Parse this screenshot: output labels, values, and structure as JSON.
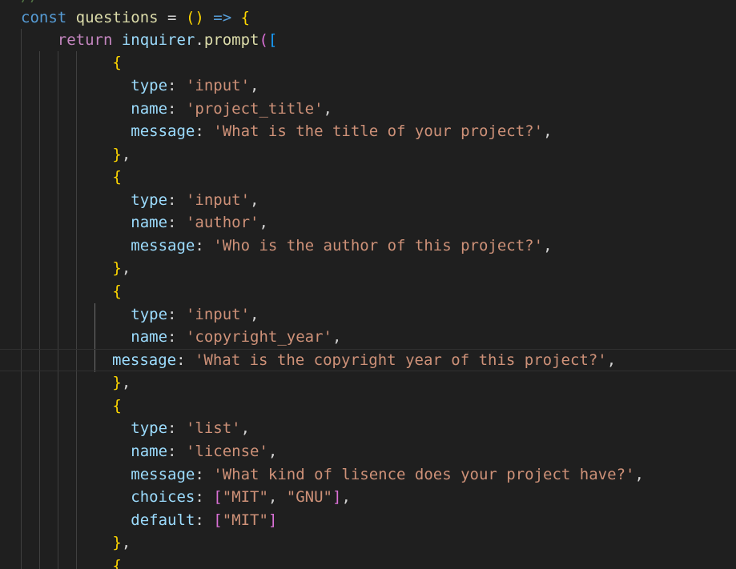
{
  "editor": {
    "ghost_comment": "// ---------------------------------------------------",
    "header": {
      "kw_const": "const",
      "name": "questions",
      "eq": " = ",
      "parens": "()",
      "arrow": " => ",
      "brace": "{"
    },
    "return_line": {
      "kw_return": "return",
      "obj": "inquirer",
      "dot": ".",
      "fn": "prompt",
      "paren": "(",
      "bracket": "["
    },
    "open_brace": "{",
    "close_brace": "}",
    "comma": ",",
    "keys": {
      "type": "type",
      "name": "name",
      "message": "message",
      "choices": "choices",
      "default": "default"
    },
    "colon": ": ",
    "questions": [
      {
        "type": "'input'",
        "name": "'project_title'",
        "message": "'What is the title of your project?'"
      },
      {
        "type": "'input'",
        "name": "'author'",
        "message": "'Who is the author of this project?'"
      },
      {
        "type": "'input'",
        "name": "'copyright_year'",
        "message": "'What is the copyright year of this project?'"
      },
      {
        "type": "'list'",
        "name": "'license'",
        "message": "'What kind of lisence does your project have?'",
        "choices": [
          "\"MIT\"",
          "\"GNU\""
        ],
        "default": "\"MIT\""
      }
    ],
    "colors": {
      "background": "#1f1f1f",
      "keyword": "#569cd6",
      "control": "#c586c0",
      "variable": "#9cdcfe",
      "function": "#dcdcaa",
      "string": "#ce9178",
      "bracket_level_1": "#ffd700",
      "bracket_level_2": "#da70d6",
      "bracket_level_3": "#179fff"
    }
  }
}
